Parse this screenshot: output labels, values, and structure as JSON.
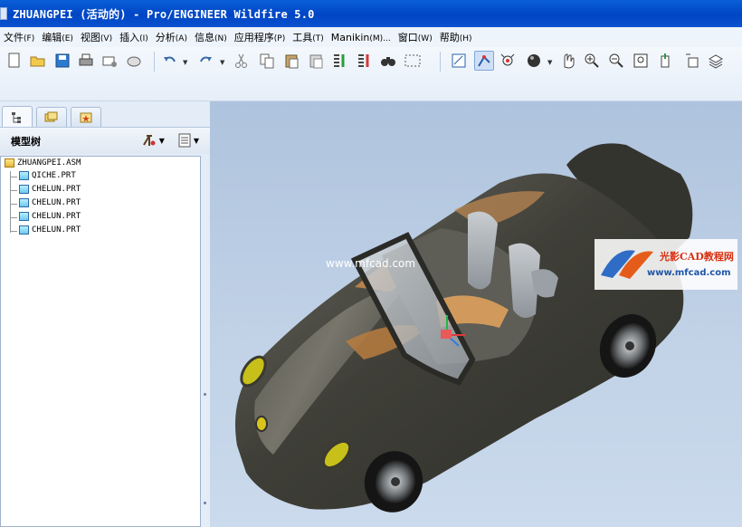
{
  "window": {
    "title": "ZHUANGPEI (活动的) - Pro/ENGINEER Wildfire 5.0"
  },
  "menu": [
    {
      "label": "文件",
      "key": "(F)"
    },
    {
      "label": "编辑",
      "key": "(E)"
    },
    {
      "label": "视图",
      "key": "(V)"
    },
    {
      "label": "插入",
      "key": "(I)"
    },
    {
      "label": "分析",
      "key": "(A)"
    },
    {
      "label": "信息",
      "key": "(N)"
    },
    {
      "label": "应用程序",
      "key": "(P)"
    },
    {
      "label": "工具",
      "key": "(T)"
    },
    {
      "label": "Manikin",
      "key": "(M)..."
    },
    {
      "label": "窗口",
      "key": "(W)"
    },
    {
      "label": "帮助",
      "key": "(H)"
    }
  ],
  "toolbar": {
    "icons": [
      "new-file-icon",
      "open-folder-icon",
      "save-icon",
      "print-icon",
      "send-mail-icon",
      "erase-icon",
      "undo-icon",
      "redo-icon",
      "cut-icon",
      "copy-icon",
      "paste-icon",
      "paste-special-icon",
      "regenerate-icon",
      "regenerate-manager-icon",
      "find-icon",
      "select-box-icon",
      "refit-icon",
      "datum-display-icon",
      "spin-center-icon",
      "shading-icon",
      "orient-icon",
      "zoom-in-icon",
      "zoom-out-icon",
      "refit-view-icon",
      "reorient-icon",
      "annotation-display-icon",
      "layers-icon"
    ]
  },
  "model_tree": {
    "title": "模型树",
    "nodes": [
      {
        "label": "ZHUANGPEI.ASM",
        "type": "assembly"
      },
      {
        "label": "QICHE.PRT",
        "type": "part"
      },
      {
        "label": "CHELUN.PRT",
        "type": "part"
      },
      {
        "label": "CHELUN.PRT",
        "type": "part"
      },
      {
        "label": "CHELUN.PRT",
        "type": "part"
      },
      {
        "label": "CHELUN.PRT",
        "type": "part"
      }
    ]
  },
  "viewport": {
    "background_top": "#aec3dd",
    "background_bottom": "#cbdaec",
    "watermark_url": "www.mfcad.com",
    "watermark_brand": "光影CAD教程网",
    "watermark_brand_url": "www.mfcad.com"
  }
}
